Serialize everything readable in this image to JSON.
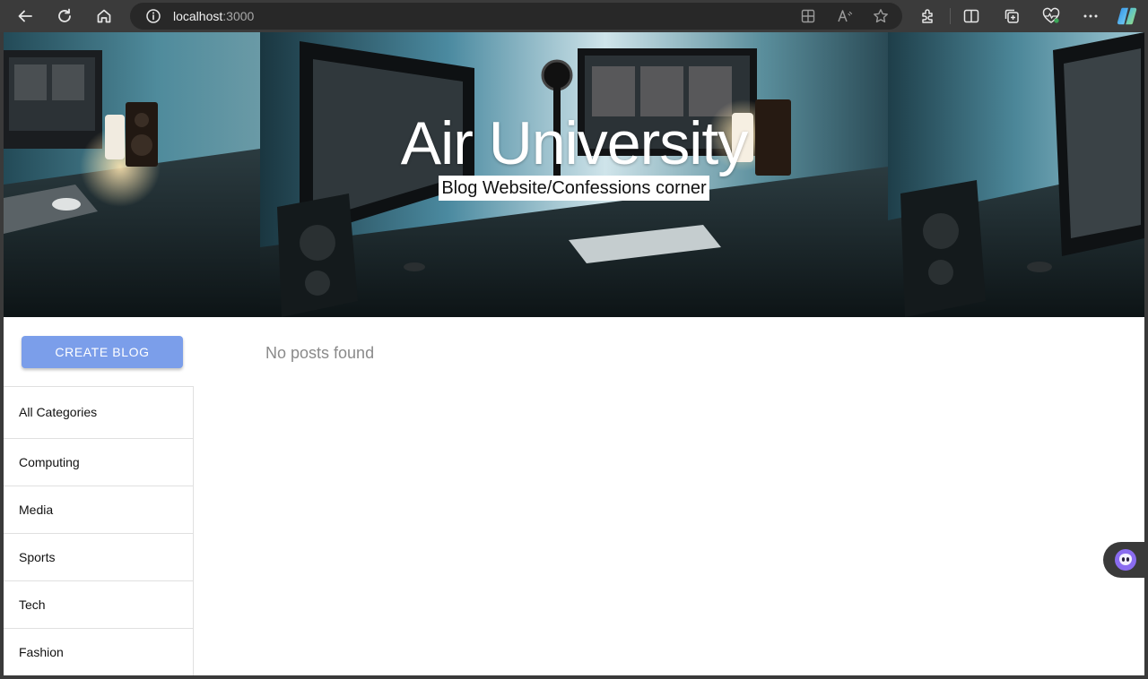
{
  "browser": {
    "address_host": "localhost",
    "address_port": ":3000",
    "icons": [
      "back-arrow-icon",
      "reload-icon",
      "home-icon",
      "info-icon",
      "app-grid-icon",
      "read-aloud-icon",
      "favorite-star-icon",
      "extensions-icon",
      "split-screen-icon",
      "collections-icon",
      "browser-essentials-icon",
      "more-menu-icon",
      "copilot-icon"
    ]
  },
  "hero": {
    "title": "Air University",
    "subtitle": "Blog Website/Confessions corner"
  },
  "actions": {
    "create_label": "CREATE BLOG"
  },
  "categories": [
    {
      "label": "All Categories"
    },
    {
      "label": "Computing"
    },
    {
      "label": "Media"
    },
    {
      "label": "Sports"
    },
    {
      "label": "Tech"
    },
    {
      "label": "Fashion"
    }
  ],
  "main": {
    "empty_message": "No posts found"
  },
  "colors": {
    "button": "#7b9eea",
    "chrome": "#3b3b3b",
    "address_bar": "#282828"
  }
}
